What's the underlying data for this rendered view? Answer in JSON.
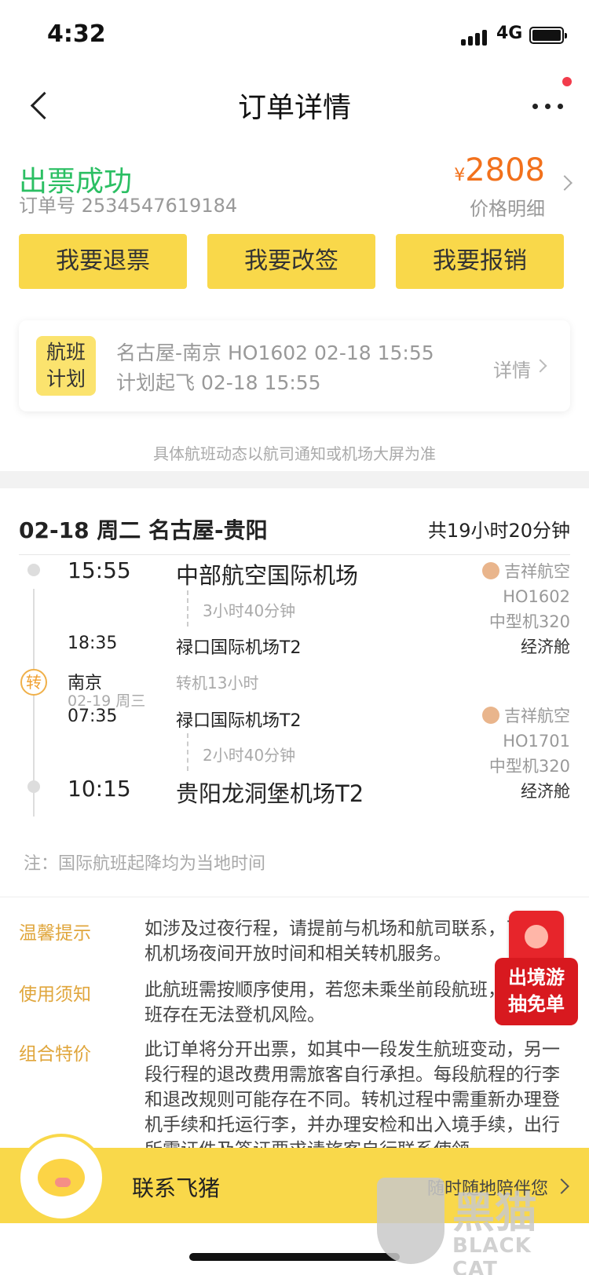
{
  "status_bar": {
    "time": "4:32",
    "network": "4G"
  },
  "nav": {
    "title": "订单详情"
  },
  "order": {
    "status": "出票成功",
    "order_no": "订单号 2534547619184",
    "currency": "¥",
    "price": "2808",
    "price_detail": "价格明细",
    "actions": [
      "我要退票",
      "我要改签",
      "我要报销"
    ],
    "plan": {
      "tag_line1": "航班",
      "tag_line2": "计划",
      "line1": "名古屋-南京 HO1602 02-18 15:55",
      "line2": "计划起飞 02-18 15:55",
      "detail": "详情"
    },
    "plan_note": "具体航班动态以航司通知或机场大屏为准"
  },
  "itinerary": {
    "header": "02-18 周二 名古屋-贵阳",
    "total": "共19小时20分钟",
    "transfer_badge": "转",
    "seg1": {
      "dep_time": "15:55",
      "dep_airport": "中部航空国际机场",
      "duration": "3小时40分钟",
      "arr_time": "18:35",
      "arr_airport": "禄口国际机场T2",
      "airline": "吉祥航空",
      "flight": "HO1602",
      "aircraft": "中型机320",
      "cabin": "经济舱"
    },
    "transfer": {
      "city": "南京",
      "date": "02-19 周三",
      "info": "转机13小时"
    },
    "seg2": {
      "dep_time": "07:35",
      "dep_airport": "禄口国际机场T2",
      "duration": "2小时40分钟",
      "arr_time": "10:15",
      "arr_airport": "贵阳龙洞堡机场T2",
      "airline": "吉祥航空",
      "flight": "HO1701",
      "aircraft": "中型机320",
      "cabin": "经济舱"
    },
    "note": "注：国际航班起降均为当地时间"
  },
  "tips": [
    {
      "label": "温馨提示",
      "text": "如涉及过夜行程，请提前与机场和航司联系，了解转机机场夜间开放时间和相关转机服务。"
    },
    {
      "label": "使用须知",
      "text": "此航班需按顺序使用，若您未乘坐前段航班，后段航班存在无法登机风险。"
    },
    {
      "label": "组合特价",
      "text": "此订单将分开出票，如其中一段发生航班变动，另一段行程的退改费用需旅客自行承担。每段航程的行李和退改规则可能存在不同。转机过程中需重新办理登机手续和托运行李，并办理安检和出入境手续，出行所需证件及签证要求请旅客自行联系使领"
    }
  ],
  "promo": {
    "line1": "出境游",
    "line2": "抽免单"
  },
  "bottom": {
    "contact": "联系飞猪",
    "slogan": "随时随地陪伴您"
  },
  "watermark": {
    "cn": "黑猫",
    "en": "BLACK CAT"
  },
  "colors": {
    "accent_yellow": "#f9d84a",
    "success_green": "#2bbf63",
    "price_orange": "#f2711c",
    "tip_label": "#e0a63c"
  }
}
